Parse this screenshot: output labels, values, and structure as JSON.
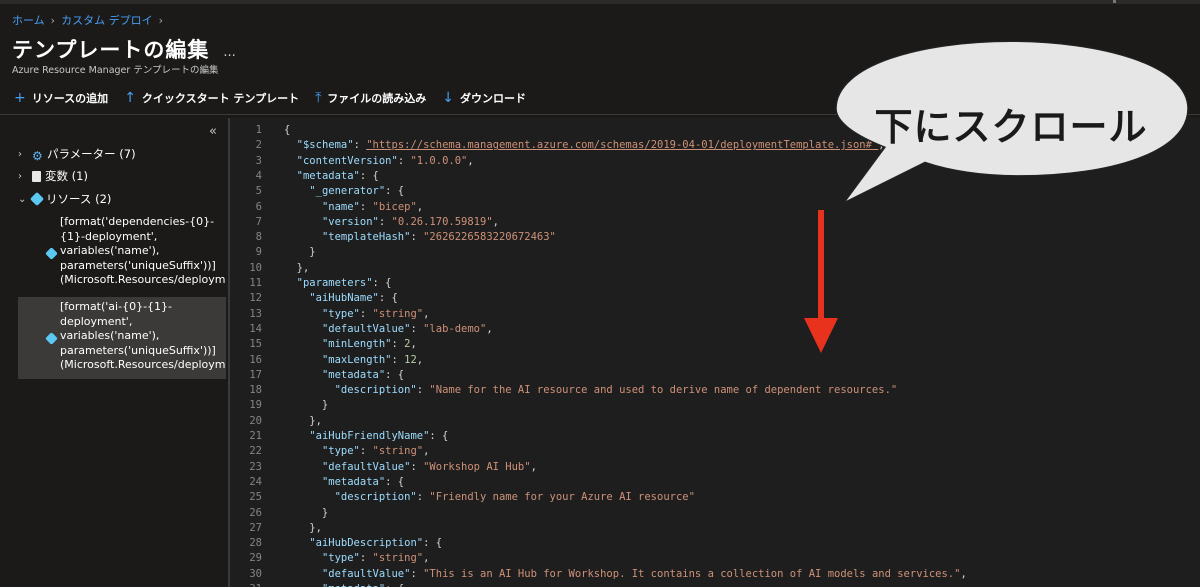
{
  "breadcrumb": [
    "ホーム",
    "カスタム デプロイ"
  ],
  "header": {
    "title": "テンプレートの編集",
    "more": "...",
    "subtitle": "Azure Resource Manager テンプレートの編集"
  },
  "toolbar": {
    "add_resource": "リソースの追加",
    "quickstart": "クイックスタート テンプレート",
    "load_file": "ファイルの読み込み",
    "download": "ダウンロード"
  },
  "tree": {
    "parameters": "パラメーター (7)",
    "variables": "変数 (1)",
    "resources": "リソース (2)",
    "resource_items": [
      [
        "[format('dependencies-{0}-",
        "{1}-deployment',",
        "variables('name'),",
        "parameters('uniqueSuffix'))]",
        "(Microsoft.Resources/deployments)"
      ],
      [
        "[format('ai-{0}-{1}-",
        "deployment',",
        "variables('name'),",
        "parameters('uniqueSuffix'))]",
        "(Microsoft.Resources/deployments)"
      ]
    ]
  },
  "editor": {
    "lines": [
      [
        [
          "p",
          "{"
        ]
      ],
      [
        [
          "p",
          "  "
        ],
        [
          "k",
          "\"$schema\""
        ],
        [
          "p",
          ": "
        ],
        [
          "u",
          "\"https://schema.management.azure.com/schemas/2019-04-01/deploymentTemplate.json#\""
        ],
        [
          "p",
          ","
        ]
      ],
      [
        [
          "p",
          "  "
        ],
        [
          "k",
          "\"contentVersion\""
        ],
        [
          "p",
          ": "
        ],
        [
          "s",
          "\"1.0.0.0\""
        ],
        [
          "p",
          ","
        ]
      ],
      [
        [
          "p",
          "  "
        ],
        [
          "k",
          "\"metadata\""
        ],
        [
          "p",
          ": {"
        ]
      ],
      [
        [
          "p",
          "    "
        ],
        [
          "k",
          "\"_generator\""
        ],
        [
          "p",
          ": {"
        ]
      ],
      [
        [
          "p",
          "      "
        ],
        [
          "k",
          "\"name\""
        ],
        [
          "p",
          ": "
        ],
        [
          "s",
          "\"bicep\""
        ],
        [
          "p",
          ","
        ]
      ],
      [
        [
          "p",
          "      "
        ],
        [
          "k",
          "\"version\""
        ],
        [
          "p",
          ": "
        ],
        [
          "s",
          "\"0.26.170.59819\""
        ],
        [
          "p",
          ","
        ]
      ],
      [
        [
          "p",
          "      "
        ],
        [
          "k",
          "\"templateHash\""
        ],
        [
          "p",
          ": "
        ],
        [
          "s",
          "\"2626226583220672463\""
        ]
      ],
      [
        [
          "p",
          "    }"
        ]
      ],
      [
        [
          "p",
          "  },"
        ]
      ],
      [
        [
          "p",
          "  "
        ],
        [
          "k",
          "\"parameters\""
        ],
        [
          "p",
          ": {"
        ]
      ],
      [
        [
          "p",
          "    "
        ],
        [
          "k",
          "\"aiHubName\""
        ],
        [
          "p",
          ": {"
        ]
      ],
      [
        [
          "p",
          "      "
        ],
        [
          "k",
          "\"type\""
        ],
        [
          "p",
          ": "
        ],
        [
          "s",
          "\"string\""
        ],
        [
          "p",
          ","
        ]
      ],
      [
        [
          "p",
          "      "
        ],
        [
          "k",
          "\"defaultValue\""
        ],
        [
          "p",
          ": "
        ],
        [
          "s",
          "\"lab-demo\""
        ],
        [
          "p",
          ","
        ]
      ],
      [
        [
          "p",
          "      "
        ],
        [
          "k",
          "\"minLength\""
        ],
        [
          "p",
          ": "
        ],
        [
          "n",
          "2"
        ],
        [
          "p",
          ","
        ]
      ],
      [
        [
          "p",
          "      "
        ],
        [
          "k",
          "\"maxLength\""
        ],
        [
          "p",
          ": "
        ],
        [
          "n",
          "12"
        ],
        [
          "p",
          ","
        ]
      ],
      [
        [
          "p",
          "      "
        ],
        [
          "k",
          "\"metadata\""
        ],
        [
          "p",
          ": {"
        ]
      ],
      [
        [
          "p",
          "        "
        ],
        [
          "k",
          "\"description\""
        ],
        [
          "p",
          ": "
        ],
        [
          "s",
          "\"Name for the AI resource and used to derive name of dependent resources.\""
        ]
      ],
      [
        [
          "p",
          "      }"
        ]
      ],
      [
        [
          "p",
          "    },"
        ]
      ],
      [
        [
          "p",
          "    "
        ],
        [
          "k",
          "\"aiHubFriendlyName\""
        ],
        [
          "p",
          ": {"
        ]
      ],
      [
        [
          "p",
          "      "
        ],
        [
          "k",
          "\"type\""
        ],
        [
          "p",
          ": "
        ],
        [
          "s",
          "\"string\""
        ],
        [
          "p",
          ","
        ]
      ],
      [
        [
          "p",
          "      "
        ],
        [
          "k",
          "\"defaultValue\""
        ],
        [
          "p",
          ": "
        ],
        [
          "s",
          "\"Workshop AI Hub\""
        ],
        [
          "p",
          ","
        ]
      ],
      [
        [
          "p",
          "      "
        ],
        [
          "k",
          "\"metadata\""
        ],
        [
          "p",
          ": {"
        ]
      ],
      [
        [
          "p",
          "        "
        ],
        [
          "k",
          "\"description\""
        ],
        [
          "p",
          ": "
        ],
        [
          "s",
          "\"Friendly name for your Azure AI resource\""
        ]
      ],
      [
        [
          "p",
          "      }"
        ]
      ],
      [
        [
          "p",
          "    },"
        ]
      ],
      [
        [
          "p",
          "    "
        ],
        [
          "k",
          "\"aiHubDescription\""
        ],
        [
          "p",
          ": {"
        ]
      ],
      [
        [
          "p",
          "      "
        ],
        [
          "k",
          "\"type\""
        ],
        [
          "p",
          ": "
        ],
        [
          "s",
          "\"string\""
        ],
        [
          "p",
          ","
        ]
      ],
      [
        [
          "p",
          "      "
        ],
        [
          "k",
          "\"defaultValue\""
        ],
        [
          "p",
          ": "
        ],
        [
          "s",
          "\"This is an AI Hub for Workshop. It contains a collection of AI models and services.\""
        ],
        [
          "p",
          ","
        ]
      ],
      [
        [
          "p",
          "      "
        ],
        [
          "k",
          "\"metadata\""
        ],
        [
          "p",
          ": {"
        ]
      ]
    ]
  },
  "callout": {
    "text": "下にスクロール",
    "bubble_color": "#e6e6e6",
    "arrow_color": "#e8321e"
  },
  "colors": {
    "accent": "#479ef5",
    "background": "#1b1a19",
    "editor_bg": "#1e1e1e"
  }
}
